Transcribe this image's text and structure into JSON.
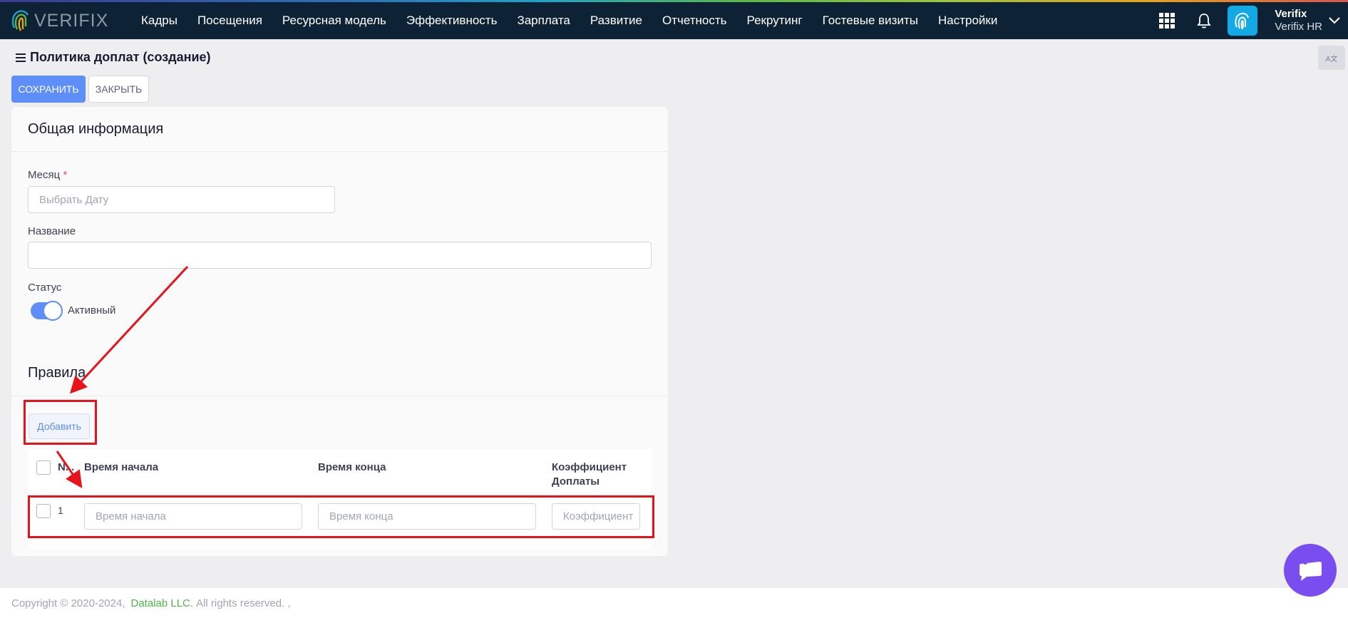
{
  "brand": {
    "name": "VERIFIX"
  },
  "nav": {
    "items": [
      "Кадры",
      "Посещения",
      "Ресурсная модель",
      "Эффективность",
      "Зарплата",
      "Развитие",
      "Отчетность",
      "Рекрутинг",
      "Гостевые визиты",
      "Настройки"
    ]
  },
  "user": {
    "name": "Verifix",
    "org": "Verifix HR"
  },
  "page": {
    "title": "Политика доплат (создание)",
    "lang_label": "A文"
  },
  "toolbar": {
    "save_label": "СОХРАНИТЬ",
    "close_label": "ЗАКРЫТЬ"
  },
  "general": {
    "title": "Общая информация",
    "month_label": "Месяц",
    "month_required": "*",
    "month_placeholder": "Выбрать Дату",
    "name_label": "Название",
    "name_value": "",
    "status_label": "Статус",
    "status_value": "Активный",
    "status_active": true
  },
  "rules": {
    "title": "Правила",
    "add_label": "Добавить",
    "columns": [
      "N...",
      "Время начала",
      "Время конца",
      "Коэффициент Доплаты"
    ],
    "rows": [
      {
        "num": "1",
        "start_placeholder": "Время начала",
        "end_placeholder": "Время конца",
        "coef_placeholder": "Коэффициент"
      }
    ]
  },
  "footer": {
    "copyright": "Copyright © 2020-2024,",
    "company": "Datalab LLC.",
    "rights": "All rights reserved. ,"
  },
  "colors": {
    "topbar": "#0e2235",
    "primary": "#5e8ef7",
    "annotation": "#e8131a",
    "chat": "#7a4df0"
  }
}
